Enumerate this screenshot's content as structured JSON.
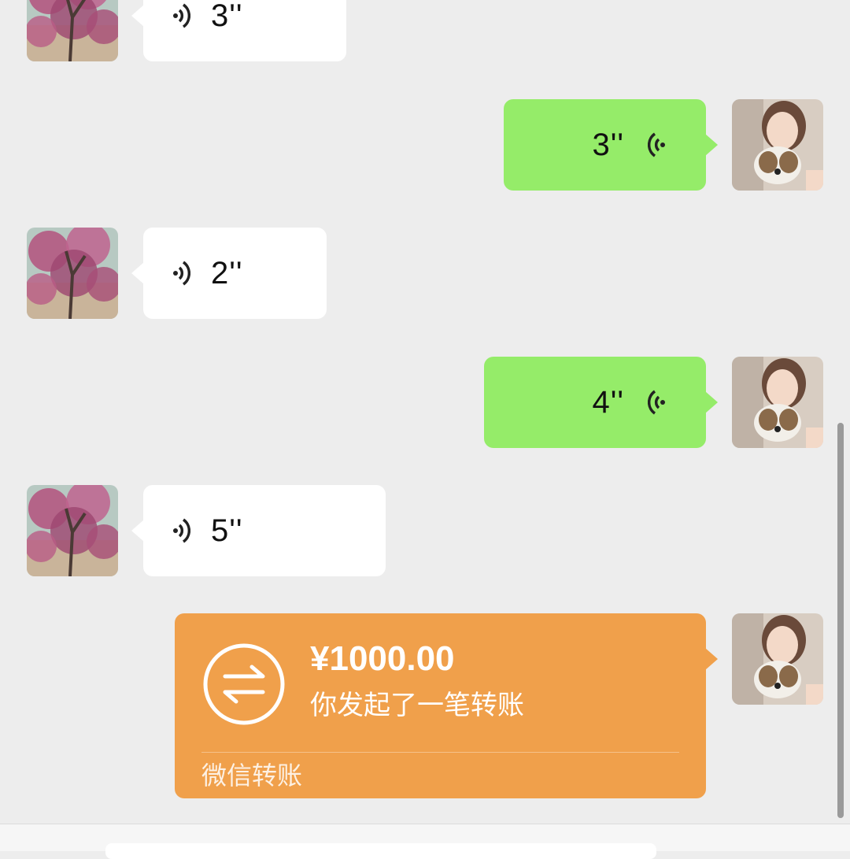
{
  "chat": {
    "messages": [
      {
        "direction": "incoming",
        "type": "voice",
        "duration": "3''"
      },
      {
        "direction": "outgoing",
        "type": "voice",
        "duration": "3''"
      },
      {
        "direction": "incoming",
        "type": "voice",
        "duration": "2''"
      },
      {
        "direction": "outgoing",
        "type": "voice",
        "duration": "4''"
      },
      {
        "direction": "incoming",
        "type": "voice",
        "duration": "5''"
      },
      {
        "direction": "outgoing",
        "type": "transfer",
        "amount": "¥1000.00",
        "description": "你发起了一笔转账",
        "footer": "微信转账"
      }
    ]
  },
  "colors": {
    "background": "#ededed",
    "incoming_bubble": "#ffffff",
    "outgoing_bubble": "#95ec69",
    "transfer_card": "#f0a04b"
  },
  "icons": {
    "voice": "voice-wave-icon",
    "transfer": "transfer-arrows-icon"
  }
}
